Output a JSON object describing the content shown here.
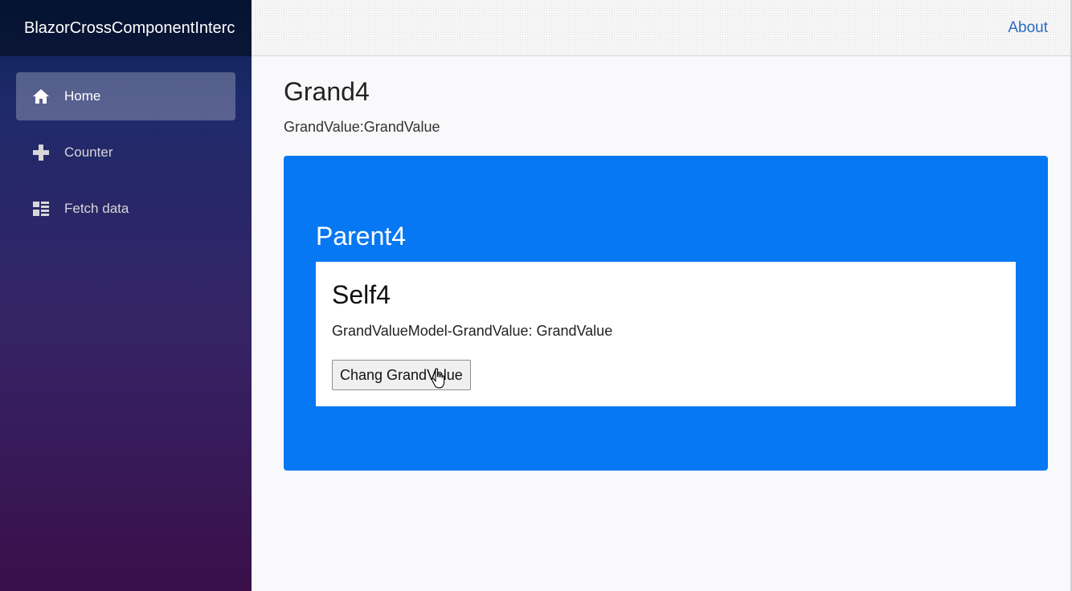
{
  "app": {
    "brand": "BlazorCrossComponentInterc"
  },
  "sidebar": {
    "items": [
      {
        "label": "Home",
        "icon": "home-icon",
        "active": true
      },
      {
        "label": "Counter",
        "icon": "plus-icon",
        "active": false
      },
      {
        "label": "Fetch data",
        "icon": "list-icon",
        "active": false
      }
    ]
  },
  "header": {
    "about_label": "About"
  },
  "grand": {
    "title": "Grand4",
    "value_label": "GrandValue:",
    "value": "GrandValue"
  },
  "parent": {
    "title": "Parent4"
  },
  "self": {
    "title": "Self4",
    "value_text": "GrandValueModel-GrandValue: GrandValue",
    "button_label": "Chang GrandValue"
  },
  "colors": {
    "parent_background": "#0678f3",
    "link": "#2a6bc4",
    "sidebar_top": "#082255",
    "sidebar_bottom": "#3a0f4a"
  }
}
